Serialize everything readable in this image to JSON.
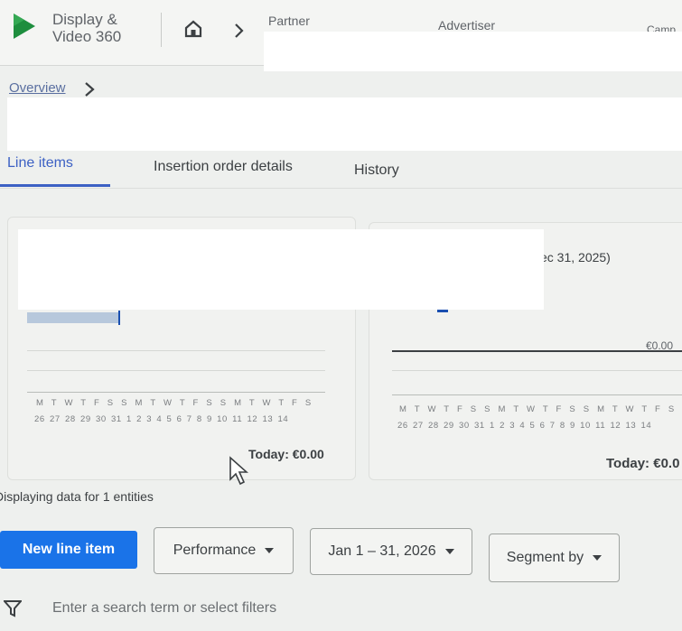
{
  "header": {
    "product_line1": "Display &",
    "product_line2": "Video 360",
    "partner_label": "Partner",
    "advertiser_label": "Advertiser",
    "campaign_label": "Camp"
  },
  "breadcrumb": {
    "overview_label": "Overview"
  },
  "tabs": [
    {
      "label": "Line items",
      "active": true
    },
    {
      "label": "Insertion order details",
      "active": false
    },
    {
      "label": "History",
      "active": false
    }
  ],
  "left_card": {
    "days": "M T W T F S S M T W T F S S M T W T F S",
    "dates": "26 27 28 29 30 31 1 2 3 4 5 6 7 8 9 10 11 12 13 14",
    "today_label": "Today: €0.00"
  },
  "right_card": {
    "date_range_fragment": "ec 31, 2025)",
    "value_fragment": "€0.00",
    "days": "M T W T F S S M T W T F S S M T W T F S",
    "dates": "26 27 28 29 30 31 1 2 3 4 5 6 7 8 9 10 11 12 13 14",
    "today_label": "Today: €0.0"
  },
  "status_text": "Displaying data for 1 entities",
  "toolbar": {
    "new_line_item_label": "New line item",
    "performance_label": "Performance",
    "date_range_label": "Jan 1 – 31, 2026",
    "segment_label": "Segment by"
  },
  "search": {
    "placeholder": "Enter a search term or select filters"
  },
  "colors": {
    "accent": "#1a73e8",
    "tab_active": "#3c61c4",
    "logo_green": "#1e8e3e"
  }
}
